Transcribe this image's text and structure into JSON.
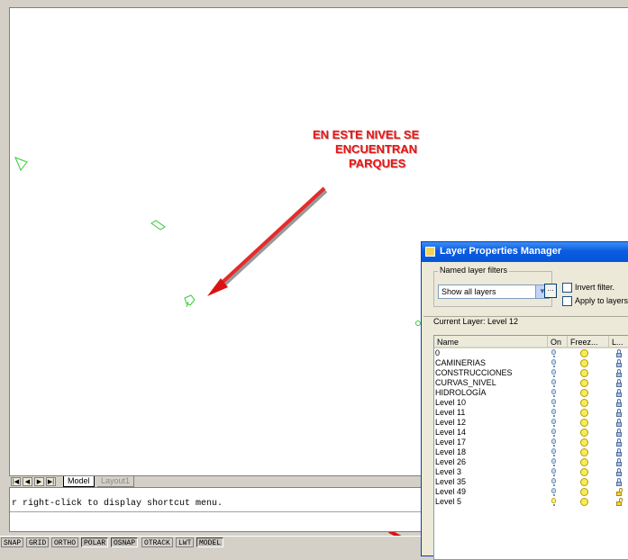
{
  "annotation": {
    "line1": "EN ESTE NIVEL SE",
    "line2": "ENCUENTRAN",
    "line3": "PARQUES",
    "color": "#ee1111"
  },
  "tabs": {
    "model": "Model",
    "layout1": "Layout1"
  },
  "nav_icons": [
    "first-tab-icon",
    "previous-tab-icon",
    "next-tab-icon",
    "last-tab-icon"
  ],
  "command": {
    "line1": "r right-click to display shortcut menu."
  },
  "status_buttons": [
    {
      "label": "SNAP",
      "on": false
    },
    {
      "label": "GRID",
      "on": false
    },
    {
      "label": "ORTHO",
      "on": false
    },
    {
      "label": "POLAR",
      "on": true
    },
    {
      "label": "OSNAP",
      "on": true
    },
    {
      "label": "OTRACK",
      "on": false
    },
    {
      "label": "LWT",
      "on": false
    },
    {
      "label": "MODEL",
      "on": true
    }
  ],
  "layer_manager": {
    "title": "Layer Properties Manager",
    "filters_label": "Named layer filters",
    "filter_value": "Show all layers",
    "invert_filter_label": "Invert filter.",
    "apply_label": "Apply to layers",
    "current_layer": "Current Layer:  Level 12",
    "columns": {
      "name": "Name",
      "on": "On",
      "freeze": "Freez...",
      "lock": "L..."
    },
    "layers": [
      {
        "name": "0",
        "on": true,
        "locked": true
      },
      {
        "name": "CAMINERIAS",
        "on": true,
        "locked": true
      },
      {
        "name": "CONSTRUCCIONES",
        "on": true,
        "locked": true
      },
      {
        "name": "CURVAS_NIVEL",
        "on": true,
        "locked": true
      },
      {
        "name": "HIDROLOGÍA",
        "on": true,
        "locked": true
      },
      {
        "name": "Level 10",
        "on": true,
        "locked": true
      },
      {
        "name": "Level 11",
        "on": true,
        "locked": true
      },
      {
        "name": "Level 12",
        "on": true,
        "locked": true
      },
      {
        "name": "Level 14",
        "on": true,
        "locked": true
      },
      {
        "name": "Level 17",
        "on": true,
        "locked": true
      },
      {
        "name": "Level 18",
        "on": true,
        "locked": true
      },
      {
        "name": "Level 26",
        "on": true,
        "locked": true
      },
      {
        "name": "Level 3",
        "on": true,
        "locked": true
      },
      {
        "name": "Level 35",
        "on": true,
        "locked": true
      },
      {
        "name": "Level 49",
        "on": true,
        "locked": false
      },
      {
        "name": "Level 5",
        "on": true,
        "locked": false
      }
    ]
  }
}
